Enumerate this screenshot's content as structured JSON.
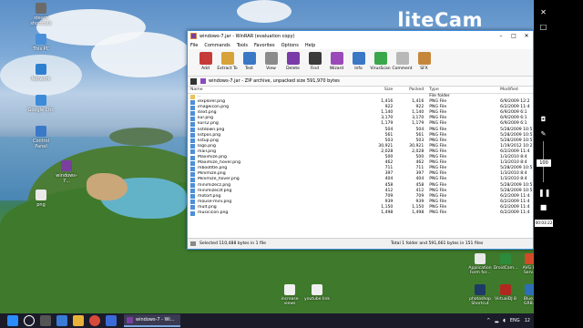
{
  "desktop": {
    "left_icons": [
      {
        "label": "steam\nshortcuts",
        "color": "#6b6b6b"
      },
      {
        "label": "This PC",
        "color": "#4a90d9"
      },
      {
        "label": "Network",
        "color": "#2f7fd0"
      },
      {
        "label": "Google Chr.",
        "color": "#3d8bd8"
      },
      {
        "label": "Control\nPanel",
        "color": "#3c78c8"
      },
      {
        "label": "windows-7...",
        "color": "#7b3fa0"
      },
      {
        "label": "png",
        "color": "#e9e9e9"
      }
    ],
    "right_icons": [
      {
        "label": "Application\nForm for...",
        "color": "#e8e8e8"
      },
      {
        "label": "DroidCam...",
        "color": "#2d8b3c"
      },
      {
        "label": "AVG PC\nServ...",
        "color": "#d24a2a"
      },
      {
        "label": "photoshop\nShortcut",
        "color": "#1e3a66"
      },
      {
        "label": "VirtualDJ 8",
        "color": "#b0281f"
      },
      {
        "label": "Blue...\nGRB...",
        "color": "#2c6fb8"
      }
    ],
    "bottom_icons": [
      {
        "label": "increase\nviews",
        "color": "#f0f0f0"
      },
      {
        "label": "youtube link",
        "color": "#f0f0f0"
      }
    ],
    "watermark": "liteCam"
  },
  "winrar": {
    "title": "windows-7.jar - WinRAR (evaluation copy)",
    "menu": [
      "File",
      "Commands",
      "Tools",
      "Favorites",
      "Options",
      "Help"
    ],
    "toolbar": [
      {
        "label": "Add",
        "color": "#c63a3a"
      },
      {
        "label": "Extract To",
        "color": "#d7a23a"
      },
      {
        "label": "Test",
        "color": "#3a78c6"
      },
      {
        "label": "View",
        "color": "#8a8a8a"
      },
      {
        "label": "Delete",
        "color": "#7a3aa8"
      },
      {
        "label": "Find",
        "color": "#3a3a3a"
      },
      {
        "label": "Wizard",
        "color": "#9a4ab8"
      },
      {
        "label": "Info",
        "color": "#3a78c6"
      },
      {
        "label": "VirusScan",
        "color": "#3aa84a"
      },
      {
        "label": "Comment",
        "color": "#b8b8b8"
      },
      {
        "label": "SFX",
        "color": "#c6863a"
      }
    ],
    "address": "windows-7.jar - ZIP archive, unpacked size 591,970 bytes",
    "columns": {
      "name": "Name",
      "size": "Size",
      "packed": "Packed",
      "type": "Type",
      "modified": "Modified"
    },
    "files": [
      {
        "name": "..",
        "size": "",
        "packed": "",
        "type": "File folder",
        "modified": "",
        "folder": true
      },
      {
        "name": "iexplorer.png",
        "size": "1,416",
        "packed": "1,416",
        "type": "PNG File",
        "modified": "6/9/2009 12:2"
      },
      {
        "name": "imageicon.png",
        "size": "922",
        "packed": "922",
        "type": "PNG File",
        "modified": "6/2/2009 11:4"
      },
      {
        "name": "itext.png",
        "size": "1,140",
        "packed": "1,140",
        "type": "PNG File",
        "modified": "6/9/2009 6:1"
      },
      {
        "name": "kur.png",
        "size": "3,170",
        "packed": "3,170",
        "type": "PNG File",
        "modified": "6/9/2009 6:1"
      },
      {
        "name": "kurs2.png",
        "size": "1,179",
        "packed": "1,179",
        "type": "PNG File",
        "modified": "6/9/2009 6:1"
      },
      {
        "name": "listdown.png",
        "size": "504",
        "packed": "504",
        "type": "PNG File",
        "modified": "5/28/2009 10:5"
      },
      {
        "name": "listpos.png",
        "size": "561",
        "packed": "561",
        "type": "PNG File",
        "modified": "5/28/2009 10:5"
      },
      {
        "name": "listup.png",
        "size": "503",
        "packed": "503",
        "type": "PNG File",
        "modified": "5/28/2009 10:5"
      },
      {
        "name": "logo.png",
        "size": "30,921",
        "packed": "30,921",
        "type": "PNG File",
        "modified": "1/19/2012 10:2"
      },
      {
        "name": "mail.png",
        "size": "2,028",
        "packed": "2,028",
        "type": "PNG File",
        "modified": "6/2/2009 11:4"
      },
      {
        "name": "Maximize.png",
        "size": "500",
        "packed": "500",
        "type": "PNG File",
        "modified": "1/3/2010 8:4"
      },
      {
        "name": "Maximize_hover.png",
        "size": "462",
        "packed": "462",
        "type": "PNG File",
        "modified": "1/3/2010 8:4"
      },
      {
        "name": "mbootltle.png",
        "size": "711",
        "packed": "711",
        "type": "PNG File",
        "modified": "5/28/2009 10:5"
      },
      {
        "name": "Minimize.png",
        "size": "397",
        "packed": "397",
        "type": "PNG File",
        "modified": "1/3/2010 8:4"
      },
      {
        "name": "Minimize_hover.png",
        "size": "404",
        "packed": "404",
        "type": "PNG File",
        "modified": "1/3/2010 8:4"
      },
      {
        "name": "minimizecz.png",
        "size": "458",
        "packed": "458",
        "type": "PNG File",
        "modified": "5/28/2009 10:5"
      },
      {
        "name": "minimizeczf.png",
        "size": "412",
        "packed": "412",
        "type": "PNG File",
        "modified": "5/28/2009 10:5"
      },
      {
        "name": "motorf.png",
        "size": "709",
        "packed": "709",
        "type": "PNG File",
        "modified": "6/2/2009 11:4"
      },
      {
        "name": "mouse-mini.png",
        "size": "939",
        "packed": "939",
        "type": "PNG File",
        "modified": "6/2/2009 11:4"
      },
      {
        "name": "mult.png",
        "size": "1,150",
        "packed": "1,150",
        "type": "PNG File",
        "modified": "6/2/2009 11:4"
      },
      {
        "name": "musicicon.png",
        "size": "1,498",
        "packed": "1,498",
        "type": "PNG File",
        "modified": "6/2/2009 11:4"
      }
    ],
    "status_left": "Selected 110,488 bytes in 1 file",
    "status_right": "Total 1 folder and 591,661 bytes in 151 files"
  },
  "taskbar": {
    "active_task": "windows-7 - Wi...",
    "tray_lang": "ENG",
    "tray_time": "12"
  },
  "recorder": {
    "zoom": "100",
    "timer": "00:03:22"
  }
}
